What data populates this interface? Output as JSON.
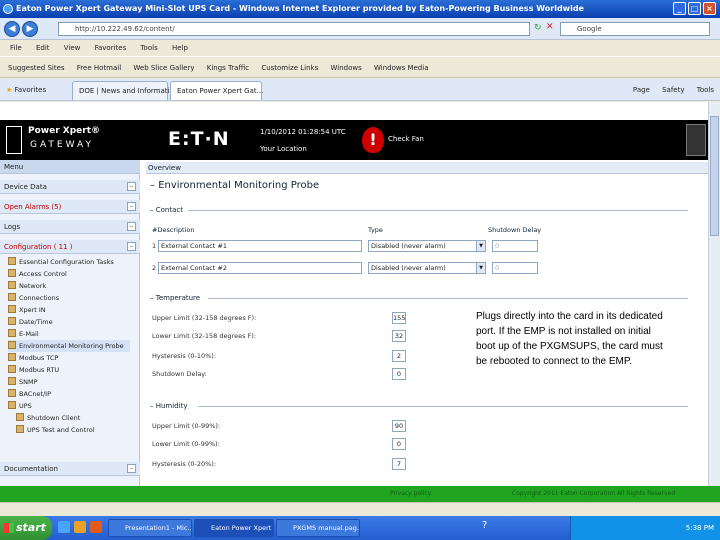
{
  "window": {
    "title": "Eaton Power Xpert Gateway Mini-Slot UPS Card - Windows Internet Explorer provided by Eaton-Powering Business Worldwide"
  },
  "browser": {
    "address": "http://10.222.49.62/content/",
    "search_placeholder": "Google",
    "menu": [
      "File",
      "Edit",
      "View",
      "Favorites",
      "Tools",
      "Help"
    ],
    "links": [
      "Suggested Sites",
      "Free Hotmail",
      "Web Slice Gallery",
      "Kings Traffic",
      "Customize Links",
      "Windows",
      "Windows Media"
    ],
    "favorites_label": "Favorites",
    "tabs": [
      "DOE | News and Information",
      "Eaton Power Xpert Gat..."
    ],
    "commands": [
      "Page",
      "Safety",
      "Tools"
    ]
  },
  "header": {
    "product_line1": "Power Xpert®",
    "product_line2": "GATEWAY",
    "brand": "E:T·N",
    "datetime": "1/10/2012 01:28:54 UTC",
    "location": "Your Location",
    "alarm_text": "Check Fan"
  },
  "sidebar": {
    "menu_header": "Menu",
    "sections": [
      "Device Data",
      "Open Alarms (5)",
      "Logs",
      "Configuration ( 11 )"
    ],
    "items": [
      "Essential Configuration Tasks",
      "Access Control",
      "Network",
      "Connections",
      "Xpert IN",
      "Date/Time",
      "E-Mail",
      "Environmental Monitoring Probe",
      "Modbus TCP",
      "Modbus RTU",
      "SNMP",
      "BACnet/IP",
      "UPS",
      "Shutdown Client",
      "UPS Test and Control"
    ],
    "documentation": "Documentation"
  },
  "content": {
    "overview": "Overview",
    "title": "Environmental Monitoring Probe",
    "contact": {
      "label": "Contact",
      "col_description": "#Description",
      "col_type": "Type",
      "col_delay": "Shutdown Delay",
      "rows": [
        {
          "num": "1",
          "description": "External Contact #1",
          "type": "Disabled (never alarm)",
          "delay": "0"
        },
        {
          "num": "2",
          "description": "External Contact #2",
          "type": "Disabled (never alarm)",
          "delay": "0"
        }
      ]
    },
    "temperature": {
      "label": "Temperature",
      "fields": [
        {
          "label": "Upper Limit (32-158 degrees F):",
          "value": "155"
        },
        {
          "label": "Lower Limit (32-158 degrees F):",
          "value": "32"
        },
        {
          "label": "Hysteresis (0-10%):",
          "value": "2"
        },
        {
          "label": "Shutdown Delay:",
          "value": "0"
        }
      ]
    },
    "humidity": {
      "label": "Humidity",
      "fields": [
        {
          "label": "Upper Limit (0-99%):",
          "value": "90"
        },
        {
          "label": "Lower Limit (0-99%):",
          "value": "0"
        },
        {
          "label": "Hysteresis (0-20%):",
          "value": "7"
        }
      ]
    },
    "note": "Plugs directly into the card in its dedicated port. If the EMP is not installed on initial boot up of the PXGMSUPS, the card must be rebooted to connect to the EMP."
  },
  "footer": {
    "left": "Privacy policy",
    "right": "Copyright 2011 Eaton Corporation All Rights Reserved"
  },
  "taskbar": {
    "start": "start",
    "buttons": [
      "Presentation1 - Mic...",
      "Eaton Power Xpert G...",
      "PXGMS manual.pag..."
    ],
    "clock": "5:38 PM"
  }
}
